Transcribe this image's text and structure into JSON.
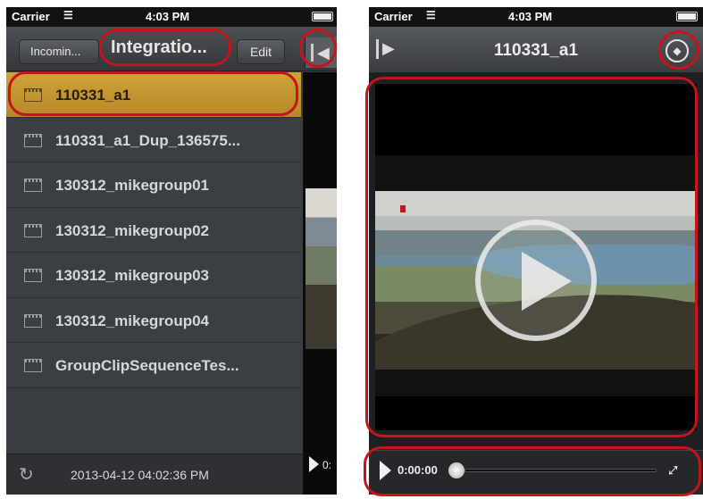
{
  "left": {
    "status": {
      "carrier": "Carrier",
      "time": "4:03 PM"
    },
    "nav": {
      "back_label": "Incomin...",
      "title": "Integratio...",
      "edit_label": "Edit"
    },
    "clips": [
      {
        "label": "110331_a1",
        "selected": true
      },
      {
        "label": "110331_a1_Dup_136575...",
        "selected": false
      },
      {
        "label": "130312_mikegroup01",
        "selected": false
      },
      {
        "label": "130312_mikegroup02",
        "selected": false
      },
      {
        "label": "130312_mikegroup03",
        "selected": false
      },
      {
        "label": "130312_mikegroup04",
        "selected": false
      },
      {
        "label": "GroupClipSequenceTes...",
        "selected": false
      }
    ],
    "preview_time_fragment": "0:",
    "footer": {
      "timestamp": "2013-04-12 04:02:36 PM"
    }
  },
  "right": {
    "status": {
      "carrier": "Carrier",
      "time": "4:03 PM"
    },
    "nav": {
      "title": "110331_a1"
    },
    "player": {
      "current_time": "0:00:00",
      "progress": 0
    }
  },
  "colors": {
    "highlight": "#c4141c",
    "selected_row": "#c89a32"
  },
  "icons": [
    "wifi-icon",
    "battery-icon",
    "clip-icon",
    "collapse-panel-icon",
    "expand-panel-icon",
    "settings-icon",
    "refresh-icon",
    "play-icon",
    "fullscreen-icon"
  ]
}
